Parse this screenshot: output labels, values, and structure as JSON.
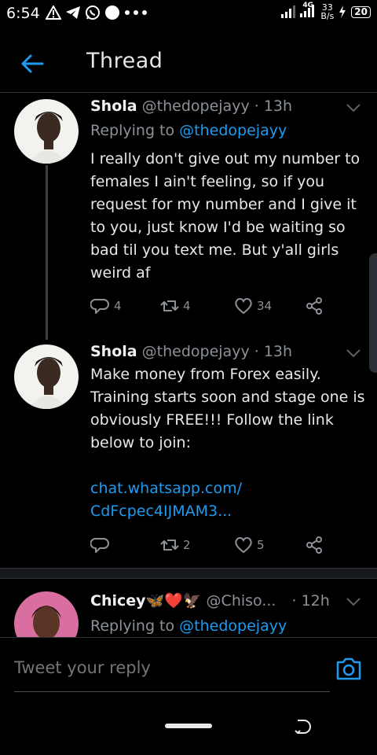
{
  "status_bar": {
    "time": "6:54",
    "network_label": "4G",
    "speed_value": "33",
    "speed_unit": "B/s",
    "battery": "20"
  },
  "header": {
    "title": "Thread"
  },
  "tweets": [
    {
      "name": "Shola",
      "handle": "@thedopejayy",
      "time": "· 13h",
      "replying_prefix": "Replying to",
      "replying_to": "@thedopejayy",
      "text": "I really don't give out my number to females I ain't feeling, so if you request for my number and I give it to you, just know I'd be waiting so bad til you text me. But y'all girls weird af",
      "replies": "4",
      "retweets": "4",
      "likes": "34"
    },
    {
      "name": "Shola",
      "handle": "@thedopejayy",
      "time": "· 13h",
      "text": "Make money from Forex easily. Training starts soon and stage one is obviously FREE!!! Follow the link below to join:",
      "link_line1": "chat.whatsapp.com/",
      "link_line2": "CdFcpec4IJMAM3...",
      "replies": "",
      "retweets": "2",
      "likes": "5"
    },
    {
      "name": "Chicey🦋❤️🦅",
      "handle": "@Chiso...",
      "time": "· 12h",
      "replying_prefix": "Replying to",
      "replying_to": "@thedopejayy"
    }
  ],
  "reply_box": {
    "placeholder": "Tweet your reply"
  },
  "colors": {
    "accent": "#1d9bf0",
    "muted": "#8b9197",
    "background": "#000000"
  },
  "icons": {
    "back": "arrow-left-icon",
    "caret": "chevron-down-icon",
    "reply": "comment-icon",
    "retweet": "retweet-icon",
    "like": "heart-icon",
    "share": "share-icon",
    "camera": "camera-icon"
  }
}
